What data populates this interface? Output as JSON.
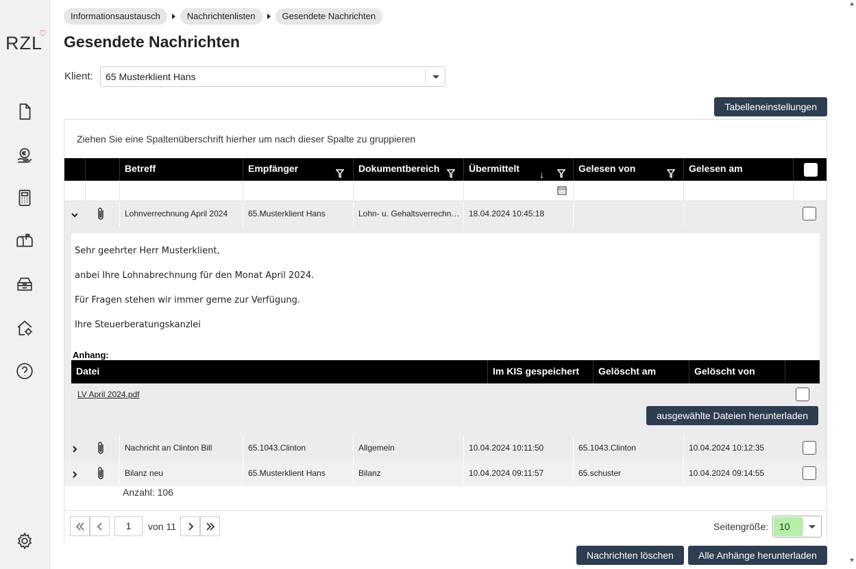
{
  "app": {
    "logo_text": "RZL",
    "logo_mark": "heart"
  },
  "sidebar": {
    "items": [
      {
        "icon": "document-icon",
        "name": "sidebar-item-documents"
      },
      {
        "icon": "coin-hand-icon",
        "name": "sidebar-item-finance"
      },
      {
        "icon": "calculator-icon",
        "name": "sidebar-item-calculator"
      },
      {
        "icon": "mailbox-icon",
        "name": "sidebar-item-mailbox"
      },
      {
        "icon": "archive-icon",
        "name": "sidebar-item-archive"
      },
      {
        "icon": "home-settings-icon",
        "name": "sidebar-item-home-settings"
      },
      {
        "icon": "help-icon",
        "name": "sidebar-item-help"
      },
      {
        "icon": "gear-icon",
        "name": "sidebar-item-settings"
      }
    ]
  },
  "breadcrumb": [
    "Informationsaustausch",
    "Nachrichtenlisten",
    "Gesendete Nachrichten"
  ],
  "page_title": "Gesendete Nachrichten",
  "client": {
    "label": "Klient:",
    "value": "65 Musterklient Hans"
  },
  "buttons": {
    "table_settings": "Tabelleneinstellungen",
    "download_selected": "ausgewählte Dateien herunterladen",
    "delete_messages": "Nachrichten löschen",
    "download_all": "Alle Anhänge herunterladen"
  },
  "grid": {
    "group_hint": "Ziehen Sie eine Spaltenüberschrift hierher um nach dieser Spalte zu gruppieren",
    "columns": [
      "Betreff",
      "Empfänger",
      "Dokumentbereich",
      "Übermittelt",
      "Gelesen von",
      "Gelesen am"
    ],
    "sort": {
      "column": "Übermittelt",
      "direction": "descending"
    },
    "rows": [
      {
        "betreff": "Lohnverrechnung April 2024",
        "empfaenger": "65.Musterklient Hans",
        "dokumentbereich": "Lohn- u. Gehaltsverrechnung",
        "uebermittelt": "18.04.2024 10:45:18",
        "gelesen_von": "",
        "gelesen_am": "",
        "expanded": true
      },
      {
        "betreff": "Nachricht an Clinton Bill",
        "empfaenger": "65.1043.Clinton",
        "dokumentbereich": "Allgemein",
        "uebermittelt": "10.04.2024 10:11:50",
        "gelesen_von": "65.1043.Clinton",
        "gelesen_am": "10.04.2024 10:12:35",
        "expanded": false
      },
      {
        "betreff": "Bilanz neu",
        "empfaenger": "65.Musterklient Hans",
        "dokumentbereich": "Bilanz",
        "uebermittelt": "10.04.2024 09:11:57",
        "gelesen_von": "65.schuster",
        "gelesen_am": "10.04.2024 09:14:55",
        "expanded": false
      }
    ],
    "detail": {
      "lines": [
        "Sehr geehrter Herr Musterklient,",
        "anbei Ihre Lohnabrechnung für den Monat April 2024.",
        "Für Fragen stehen wir immer gerne zur Verfügung.",
        "Ihre Steuerberatungskanzlei"
      ],
      "attachment_label": "Anhang:",
      "attachment_columns": [
        "Datei",
        "Im KIS gespeichert",
        "Gelöscht am",
        "Gelöscht von"
      ],
      "attachments": [
        {
          "file": "LV April 2024.pdf"
        }
      ]
    },
    "count_label": "Anzahl:",
    "count_value": "106"
  },
  "pager": {
    "page": "1",
    "of_text": "von 11",
    "size_label": "Seitengröße:",
    "size_value": "10"
  }
}
